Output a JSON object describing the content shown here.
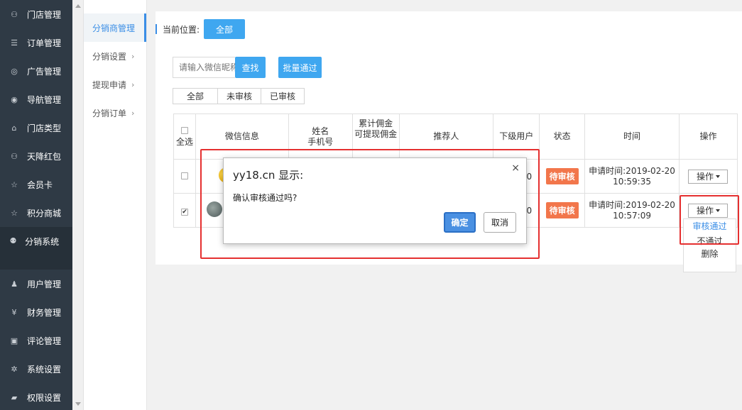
{
  "sidebar": {
    "items": [
      {
        "label": "门店管理",
        "icon": "store-icon",
        "glyph": "⚇"
      },
      {
        "label": "订单管理",
        "icon": "list-icon",
        "glyph": "☰"
      },
      {
        "label": "广告管理",
        "icon": "lifebuoy-icon",
        "glyph": "◎"
      },
      {
        "label": "导航管理",
        "icon": "compass-icon",
        "glyph": "◉"
      },
      {
        "label": "门店类型",
        "icon": "bank-icon",
        "glyph": "⌂"
      },
      {
        "label": "天降红包",
        "icon": "gift-icon",
        "glyph": "⚇"
      },
      {
        "label": "会员卡",
        "icon": "star-icon",
        "glyph": "☆"
      },
      {
        "label": "积分商城",
        "icon": "star-icon",
        "glyph": "☆"
      },
      {
        "label": "分销系统",
        "icon": "users-icon",
        "glyph": "⚉"
      },
      {
        "label": "用户管理",
        "icon": "user-icon",
        "glyph": "♟"
      },
      {
        "label": "财务管理",
        "icon": "yen-icon",
        "glyph": "¥"
      },
      {
        "label": "评论管理",
        "icon": "money-icon",
        "glyph": "▣"
      },
      {
        "label": "系统设置",
        "icon": "gear-icon",
        "glyph": "✲"
      },
      {
        "label": "权限设置",
        "icon": "lock-icon",
        "glyph": "▰"
      }
    ]
  },
  "submenu": {
    "items": [
      {
        "label": "分销商管理",
        "chevron": ""
      },
      {
        "label": "分销设置",
        "chevron": "›"
      },
      {
        "label": "提现申请",
        "chevron": "›"
      },
      {
        "label": "分销订单",
        "chevron": "›"
      }
    ]
  },
  "breadcrumb": {
    "label": "当前位置:",
    "current": "全部"
  },
  "toolbar": {
    "search_placeholder": "请输入微信昵称",
    "find_label": "查找",
    "batch_label": "批量通过"
  },
  "tabs": [
    "全部",
    "未审核",
    "已审核"
  ],
  "table": {
    "headers": {
      "select_all": "全选",
      "wechat": "微信信息",
      "name": "姓名",
      "phone": "手机号",
      "commission": "累计佣金\n可提现佣金",
      "referrer": "推荐人",
      "sub_users": "下级用户",
      "status": "状态",
      "time": "时间",
      "action": "操作"
    },
    "rows": [
      {
        "checked": false,
        "sub_users": "0",
        "status": "待审核",
        "time": "申请时间:2019-02-20 10:59:35",
        "action": "操作"
      },
      {
        "checked": true,
        "sub_users": "0",
        "status": "待审核",
        "time": "申请时间:2019-02-20 10:57:09",
        "action": "操作"
      }
    ]
  },
  "dropdown": {
    "items": [
      "审核通过",
      "不通过",
      "删除"
    ]
  },
  "dialog": {
    "title": "yy18.cn 显示:",
    "close": "×",
    "message": "确认审核通过吗?",
    "ok_label": "确定",
    "cancel_label": "取消"
  },
  "colors": {
    "sidebar_bg": "#2f3a45",
    "accent": "#3fa7f0",
    "badge": "#f2764b",
    "highlight": "#e53030"
  }
}
